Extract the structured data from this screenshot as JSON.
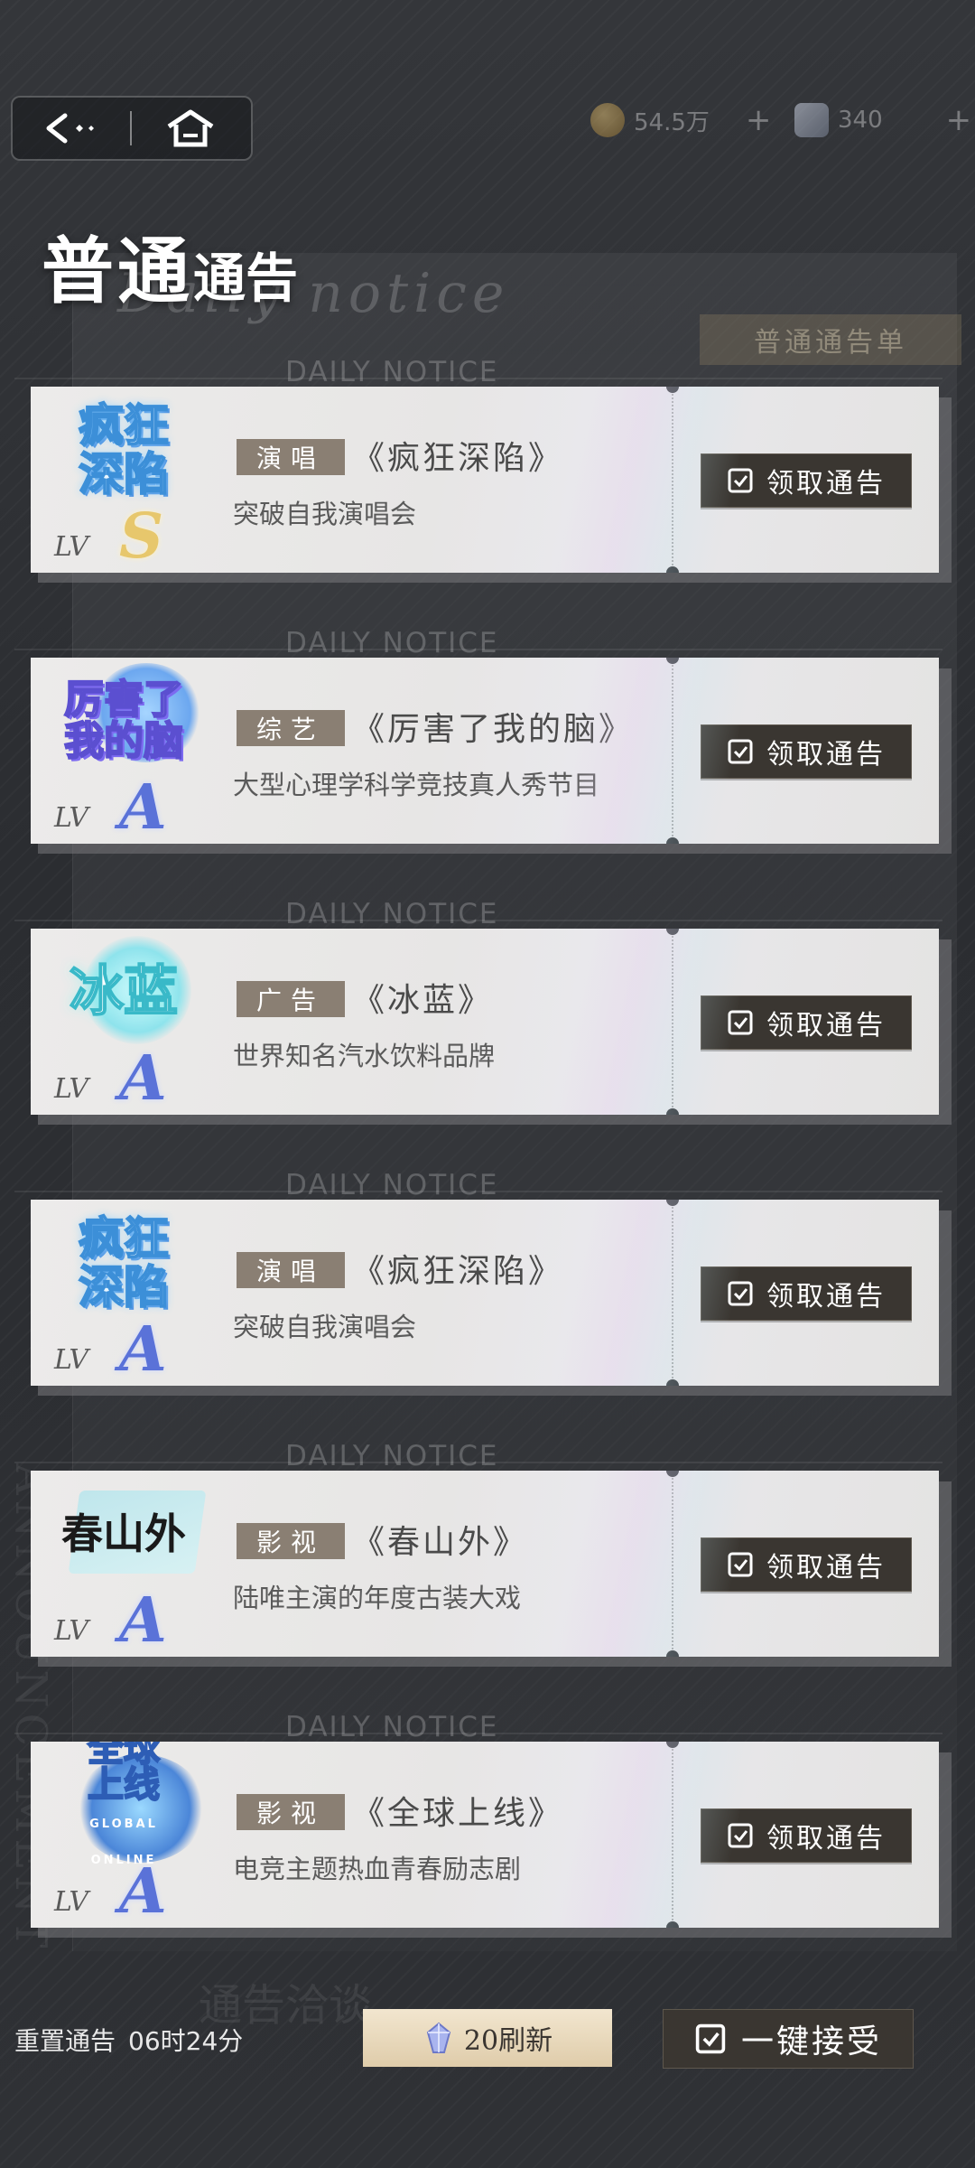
{
  "header": {
    "coins": "54.5万",
    "gems": "340",
    "title_main": "普通",
    "title_small": "通告",
    "title_sub": "Daily notice",
    "sheet_label": "普通通告单"
  },
  "card_header_text": "DAILY NOTICE",
  "cards": [
    {
      "logo": "疯狂深陷",
      "logo_style": "blue",
      "lv": "LV",
      "rank": "S",
      "category": "演唱",
      "title": "《疯狂深陷》",
      "desc": "突破自我演唱会",
      "button": "领取通告"
    },
    {
      "logo": "厉害了我的脑",
      "logo_style": "purple",
      "lv": "LV",
      "rank": "A",
      "category": "综艺",
      "title": "《厉害了我的脑》",
      "desc": "大型心理学科学竞技真人秀节目",
      "button": "领取通告"
    },
    {
      "logo": "冰蓝",
      "logo_style": "cyan",
      "lv": "LV",
      "rank": "A",
      "category": "广告",
      "title": "《冰蓝》",
      "desc": "世界知名汽水饮料品牌",
      "button": "领取通告"
    },
    {
      "logo": "疯狂深陷",
      "logo_style": "blue",
      "lv": "LV",
      "rank": "A",
      "category": "演唱",
      "title": "《疯狂深陷》",
      "desc": "突破自我演唱会",
      "button": "领取通告"
    },
    {
      "logo": "春山外",
      "logo_style": "ink",
      "lv": "LV",
      "rank": "A",
      "category": "影视",
      "title": "《春山外》",
      "desc": "陆唯主演的年度古装大戏",
      "button": "领取通告"
    },
    {
      "logo": "全球上线",
      "logo_sub": "GLOBAL ONLINE",
      "logo_style": "global",
      "lv": "LV",
      "rank": "A",
      "category": "影视",
      "title": "《全球上线》",
      "desc": "电竞主题热血青春励志剧",
      "button": "领取通告"
    }
  ],
  "footer": {
    "reset_label": "重置通告",
    "reset_time": "06时24分",
    "refresh_label": "20刷新",
    "accept_all_label": "一键接受",
    "bg_text": "通告洽谈"
  },
  "side_text": "ANNOUNCEMENT",
  "colors": {
    "accent_dark": "#3a3631",
    "category_bg": "#8a7f73",
    "rank_s": "#e7c76c",
    "rank_a": "#5a72d8"
  },
  "icons": [
    "back-icon",
    "home-icon",
    "coin-icon",
    "gem-icon",
    "plus-icon",
    "checkbox-icon",
    "crystal-icon"
  ]
}
